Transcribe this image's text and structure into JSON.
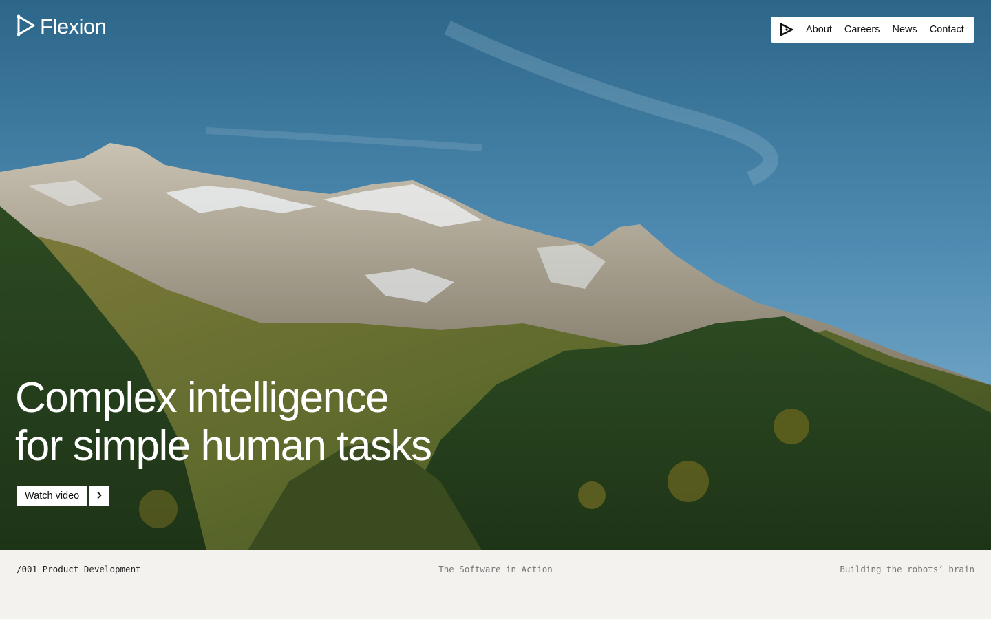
{
  "brand": {
    "name": "Flexion",
    "logo_icon": "flexion-play-mark-icon"
  },
  "nav": {
    "icon": "flexion-play-mark-icon",
    "items": [
      {
        "label": "About"
      },
      {
        "label": "Careers"
      },
      {
        "label": "News"
      },
      {
        "label": "Contact"
      }
    ]
  },
  "hero": {
    "headline_line1": "Complex intelligence",
    "headline_line2": "for simple human tasks",
    "cta_label": "Watch video",
    "cta_arrow_icon": "chevron-right-icon"
  },
  "footer": {
    "left": "/001 Product Development",
    "center": "The Software in Action",
    "right": "Building the robots’ brain"
  },
  "colors": {
    "panel_bg": "#f3f2ee",
    "nav_bg": "#ffffff",
    "text_dark": "#111111",
    "text_muted": "#777777"
  }
}
